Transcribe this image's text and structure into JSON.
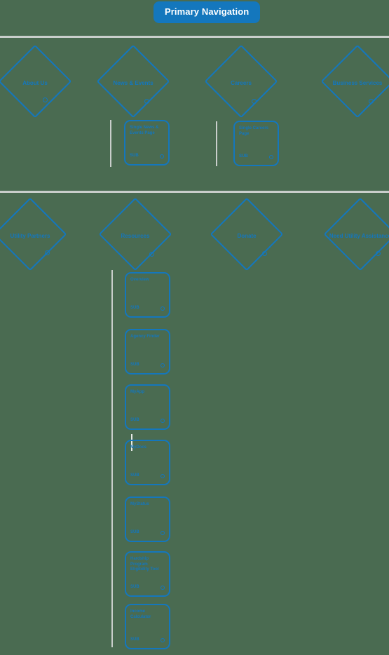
{
  "header": {
    "badge_label": "Primary Navigation",
    "badge_color": "#1477bd",
    "badge_text_color": "#ffffff"
  },
  "theme": {
    "background": "#4a6b51",
    "accent": "#1477bd",
    "divider": "#c9cecb"
  },
  "sections": [
    {
      "name": "row-one",
      "nodes": [
        {
          "label": "About Us"
        },
        {
          "label": "News & Events"
        },
        {
          "label": "Careers"
        },
        {
          "label": "Business Services"
        }
      ],
      "cards": [
        {
          "title": "Single News & Events Page",
          "sub": "SUB"
        },
        {
          "title": "Single Careers Page",
          "sub": "SUB"
        }
      ]
    },
    {
      "name": "row-two",
      "nodes": [
        {
          "label": "Utility Partners"
        },
        {
          "label": "Resources"
        },
        {
          "label": "Donate"
        },
        {
          "label": "Need Utility Assistance"
        }
      ],
      "cards": [
        {
          "title": "Overview",
          "sub": "SUB"
        },
        {
          "title": "Agency Finder",
          "sub": "SUB"
        },
        {
          "title": "MyApp",
          "sub": "SUB"
        },
        {
          "title": "MyDocs",
          "sub": "SUB"
        },
        {
          "title": "MyStatus",
          "sub": "SUB"
        },
        {
          "title": "Hardship Program Eligibility Tool",
          "sub": "SUB"
        },
        {
          "title": "Income Calculator",
          "sub": "SUB"
        }
      ]
    }
  ]
}
